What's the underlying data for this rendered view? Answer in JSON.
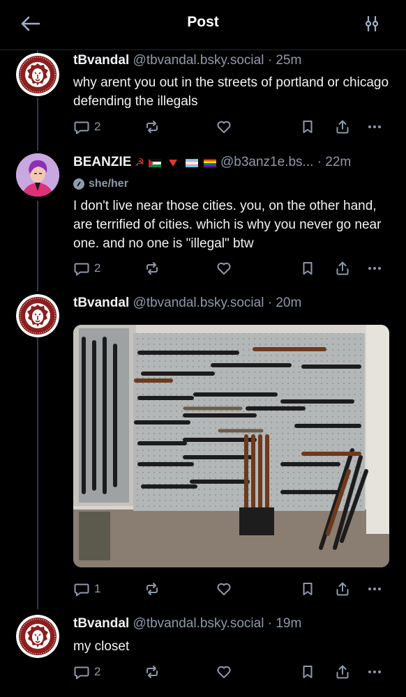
{
  "header": {
    "title": "Post"
  },
  "posts": [
    {
      "name": "tBvandal",
      "handle": "@tbvandal.bsky.social",
      "time": "· 25m",
      "text": "why arent you out in the streets of portland or chicago defending the illegals",
      "replies": "2"
    },
    {
      "name": "BEANZIE",
      "handle": "@b3anz1e.bs...",
      "time": "· 22m",
      "pronouns": "she/her",
      "text": "I don't live near those cities. you, on the other hand, are terrified of cities. which is why you never go near one. and no one is \"illegal\" btw",
      "replies": "2"
    },
    {
      "name": "tBvandal",
      "handle": "@tbvandal.bsky.social",
      "time": "· 20m",
      "text": "",
      "replies": "1"
    },
    {
      "name": "tBvandal",
      "handle": "@tbvandal.bsky.social",
      "time": "· 19m",
      "text": "my closet",
      "replies": "2"
    }
  ],
  "icons": {
    "back": "arrow-left-icon",
    "filter": "sliders-icon",
    "reply": "speech-bubble-icon",
    "repost": "repost-icon",
    "like": "heart-icon",
    "bookmark": "bookmark-icon",
    "share": "share-icon",
    "more": "ellipsis-icon"
  },
  "colors": {
    "background": "#000000",
    "text": "#f1f3f5",
    "muted": "#8d9aab",
    "thread_line": "#2e3b4b",
    "lion_red": "#8c1f1f"
  }
}
